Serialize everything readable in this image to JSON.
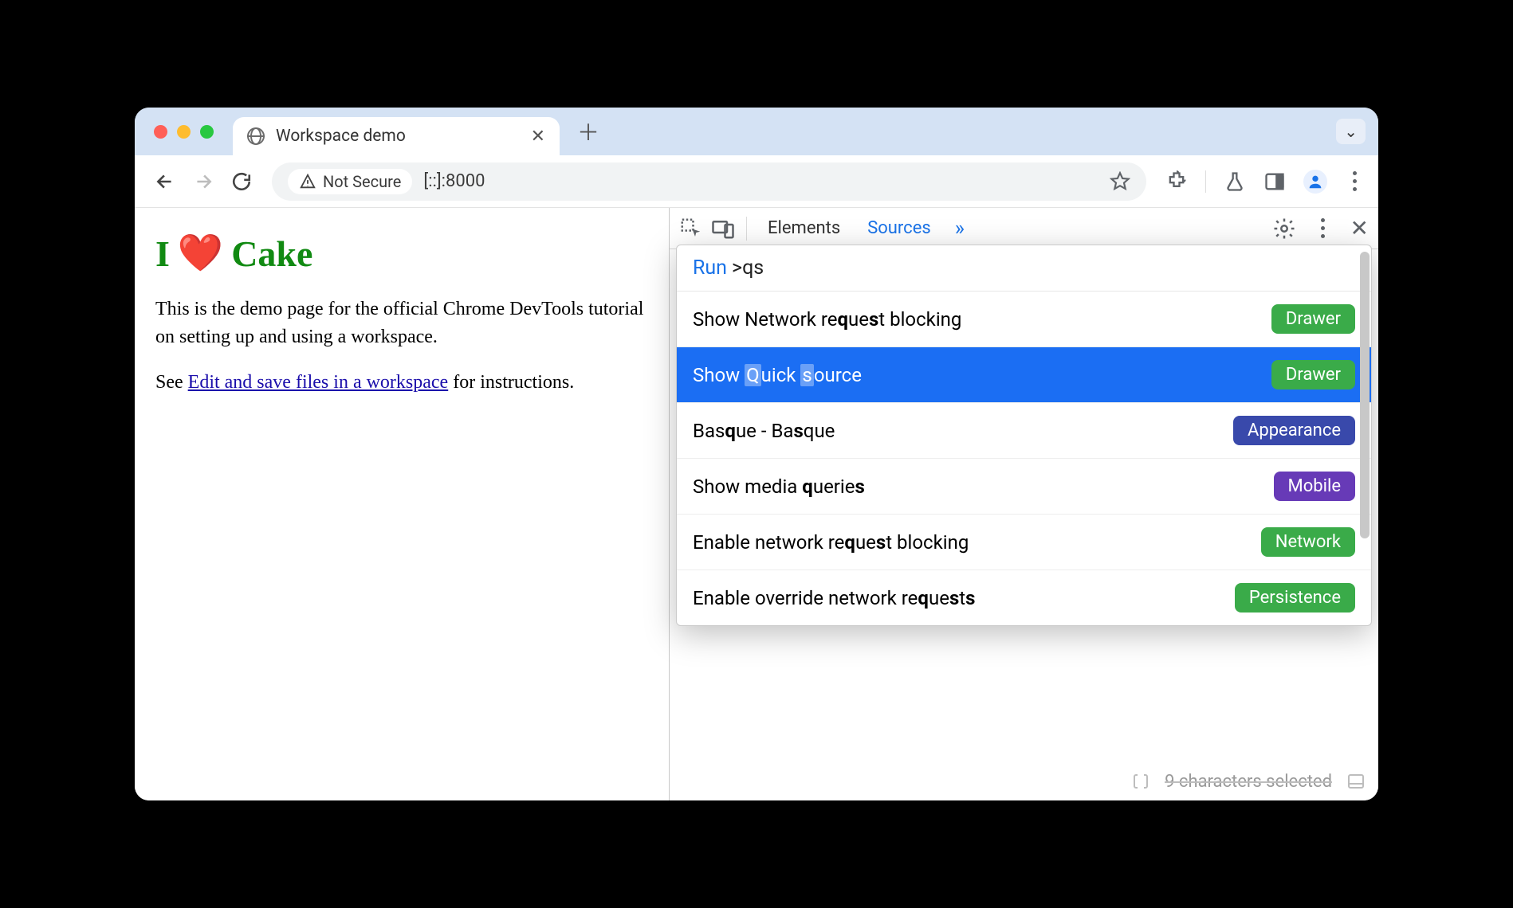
{
  "browser": {
    "tab_title": "Workspace demo",
    "not_secure": "Not Secure",
    "url": "[::]:8000"
  },
  "page": {
    "heading_pre": "I",
    "heading_post": "Cake",
    "p1": "This is the demo page for the official Chrome DevTools tutorial on setting up and using a workspace.",
    "p2_pre": "See ",
    "p2_link": "Edit and save files in a workspace",
    "p2_post": " for instructions."
  },
  "devtools": {
    "tabs": {
      "elements": "Elements",
      "sources": "Sources"
    },
    "command_menu": {
      "prefix": "Run",
      "query": ">qs",
      "items": [
        {
          "label": "Show Network request blocking",
          "bold_q": "q",
          "bold_s": "s",
          "badge": "Drawer",
          "badge_class": "b-drawer",
          "selected": false
        },
        {
          "label": "Show Quick source",
          "badge": "Drawer",
          "badge_class": "b-drawer",
          "selected": true
        },
        {
          "label": "Basque - Basque",
          "badge": "Appearance",
          "badge_class": "b-appearance",
          "selected": false
        },
        {
          "label": "Show media queries",
          "badge": "Mobile",
          "badge_class": "b-mobile",
          "selected": false
        },
        {
          "label": "Enable network request blocking",
          "badge": "Network",
          "badge_class": "b-network",
          "selected": false
        },
        {
          "label": "Enable override network requests",
          "badge": "Persistence",
          "badge_class": "b-persist",
          "selected": false
        }
      ]
    },
    "footer": "9 characters selected"
  }
}
